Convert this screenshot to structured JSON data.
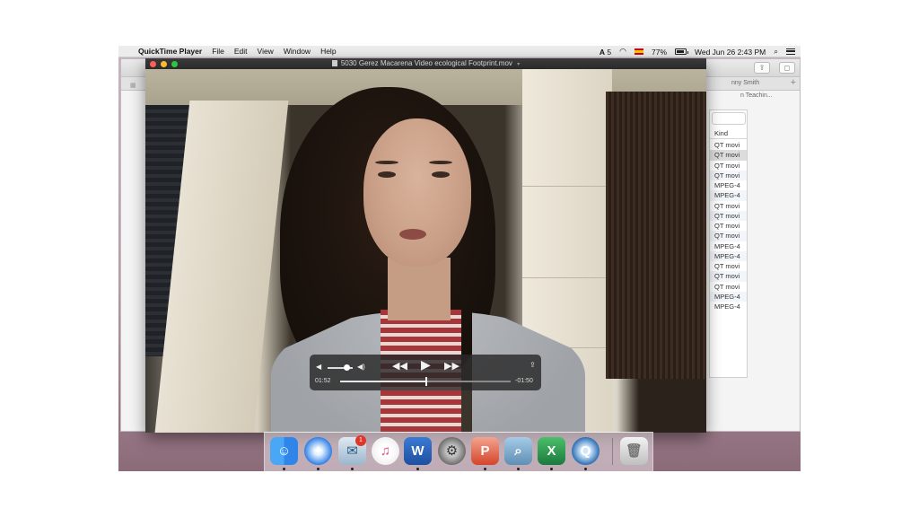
{
  "menubar": {
    "app_name": "QuickTime Player",
    "menus": [
      "File",
      "Edit",
      "View",
      "Window",
      "Help"
    ],
    "adobe_badge": "5",
    "battery": "77%",
    "clock": "Wed Jun 26  2:43 PM"
  },
  "finder": {
    "tabs": [
      "nny Smith",
      "n Teachin..."
    ],
    "plus": "+",
    "kind_header": "Kind",
    "kinds": [
      "QT movi",
      "QT movi",
      "QT movi",
      "QT movi",
      "MPEG-4",
      "MPEG-4",
      "QT movi",
      "QT movi",
      "QT movi",
      "QT movi",
      "MPEG-4",
      "MPEG-4",
      "QT movi",
      "QT movi",
      "QT movi",
      "MPEG-4",
      "MPEG-4"
    ]
  },
  "quicktime": {
    "window_title": "5030 Gerez Macarena Video ecological Footprint.mov",
    "elapsed": "01:52",
    "remaining": "-01:50",
    "progress": 0.505,
    "volume": 0.78
  },
  "dock": {
    "mail_badge": "1"
  },
  "colors": {
    "close": "#fd5f57",
    "minimize": "#fdbc2e",
    "zoom": "#28c840"
  }
}
